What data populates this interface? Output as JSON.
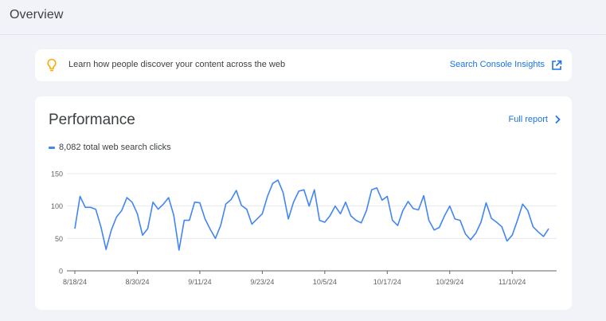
{
  "header": {
    "title": "Overview"
  },
  "insights": {
    "text": "Learn how people discover your content across the web",
    "link_label": "Search Console Insights",
    "icons": {
      "bulb": "lightbulb-icon",
      "external": "open-in-new-icon"
    }
  },
  "performance": {
    "title": "Performance",
    "full_report_label": "Full report",
    "legend_label": "8,082 total web search clicks",
    "colors": {
      "line": "#4285f4",
      "accent": "#1a73e8",
      "bulb": "#f9ab00"
    }
  },
  "chart_data": {
    "type": "line",
    "title": "",
    "xlabel": "",
    "ylabel": "",
    "ylim": [
      0,
      150
    ],
    "yticks": [
      0,
      50,
      100,
      150
    ],
    "grid": true,
    "legend": "top-left",
    "xtick_labels": [
      "8/18/24",
      "8/30/24",
      "9/11/24",
      "9/23/24",
      "10/5/24",
      "10/17/24",
      "10/29/24",
      "11/10/24"
    ],
    "xtick_positions": [
      0,
      12,
      24,
      36,
      48,
      60,
      72,
      84
    ],
    "series": [
      {
        "name": "8,082 total web search clicks",
        "values": [
          65,
          115,
          98,
          98,
          95,
          68,
          33,
          63,
          83,
          93,
          113,
          106,
          88,
          55,
          65,
          106,
          95,
          103,
          113,
          86,
          32,
          78,
          78,
          106,
          105,
          80,
          64,
          50,
          70,
          103,
          110,
          124,
          101,
          95,
          72,
          80,
          88,
          115,
          135,
          140,
          121,
          80,
          106,
          123,
          125,
          100,
          125,
          78,
          75,
          85,
          100,
          88,
          106,
          85,
          78,
          74,
          93,
          125,
          128,
          109,
          115,
          78,
          70,
          93,
          107,
          96,
          94,
          116,
          78,
          63,
          67,
          85,
          100,
          80,
          78,
          57,
          48,
          58,
          75,
          105,
          81,
          75,
          68,
          46,
          55,
          78,
          103,
          93,
          68,
          60,
          53,
          65
        ]
      }
    ]
  }
}
